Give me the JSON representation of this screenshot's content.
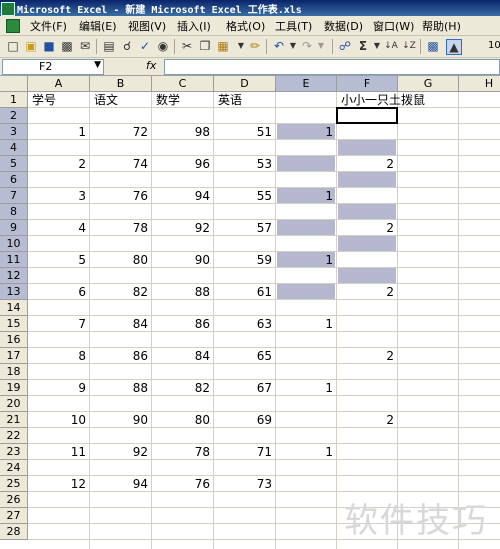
{
  "window": {
    "title": "Microsoft Excel - 新建 Microsoft Excel 工作表.xls"
  },
  "menu": [
    "文件(F)",
    "编辑(E)",
    "视图(V)",
    "插入(I)",
    "格式(O)",
    "工具(T)",
    "数据(D)",
    "窗口(W)",
    "帮助(H)"
  ],
  "toolbar": {
    "icons": [
      "new-icon",
      "open-icon",
      "save-icon",
      "permission-icon",
      "email-icon",
      "print-icon",
      "print-preview-icon",
      "spelling-icon",
      "research-icon",
      "cut-icon",
      "copy-icon",
      "paste-icon",
      "format-painter-icon",
      "undo-icon",
      "redo-icon",
      "hyperlink-icon",
      "autosum-icon",
      "sort-ascending-icon",
      "sort-descending-icon",
      "chart-wizard-icon",
      "drawing-icon"
    ],
    "zoom": "10"
  },
  "formula_bar": {
    "name_box": "F2",
    "fx": "fx",
    "content": ""
  },
  "columns": [
    "A",
    "B",
    "C",
    "D",
    "E",
    "F",
    "G",
    "H"
  ],
  "rows": [
    "1",
    "2",
    "3",
    "4",
    "5",
    "6",
    "7",
    "8",
    "9",
    "10",
    "11",
    "12",
    "13",
    "14",
    "15",
    "16",
    "17",
    "18",
    "19",
    "20",
    "21",
    "22",
    "23",
    "24",
    "25",
    "26",
    "27",
    "28"
  ],
  "headers": {
    "A1": "学号",
    "B1": "语文",
    "C1": "数学",
    "D1": "英语",
    "F1": "小小一只土拨鼠"
  },
  "data_rows": [
    {
      "row": 3,
      "A": "1",
      "B": "72",
      "C": "98",
      "D": "51",
      "E": "1",
      "F": ""
    },
    {
      "row": 5,
      "A": "2",
      "B": "74",
      "C": "96",
      "D": "53",
      "E": "",
      "F": "2"
    },
    {
      "row": 7,
      "A": "3",
      "B": "76",
      "C": "94",
      "D": "55",
      "E": "1",
      "F": ""
    },
    {
      "row": 9,
      "A": "4",
      "B": "78",
      "C": "92",
      "D": "57",
      "E": "",
      "F": "2"
    },
    {
      "row": 11,
      "A": "5",
      "B": "80",
      "C": "90",
      "D": "59",
      "E": "1",
      "F": ""
    },
    {
      "row": 13,
      "A": "6",
      "B": "82",
      "C": "88",
      "D": "61",
      "E": "",
      "F": "2"
    },
    {
      "row": 15,
      "A": "7",
      "B": "84",
      "C": "86",
      "D": "63",
      "E": "1",
      "F": ""
    },
    {
      "row": 17,
      "A": "8",
      "B": "86",
      "C": "84",
      "D": "65",
      "E": "",
      "F": "2"
    },
    {
      "row": 19,
      "A": "9",
      "B": "88",
      "C": "82",
      "D": "67",
      "E": "1",
      "F": ""
    },
    {
      "row": 21,
      "A": "10",
      "B": "90",
      "C": "80",
      "D": "69",
      "E": "",
      "F": "2"
    },
    {
      "row": 23,
      "A": "11",
      "B": "92",
      "C": "78",
      "D": "71",
      "E": "1",
      "F": ""
    },
    {
      "row": 25,
      "A": "12",
      "B": "94",
      "C": "76",
      "D": "73",
      "E": "",
      "F": ""
    }
  ],
  "highlight": {
    "color": "#b5b7cf",
    "E_rows": [
      3,
      5,
      7,
      9,
      11,
      13
    ],
    "F_rows": [
      4,
      6,
      8,
      10,
      12
    ]
  },
  "selection": {
    "active_cell": "F2",
    "selected_columns": [
      "E",
      "F"
    ],
    "selected_rows": [
      "2",
      "3",
      "4",
      "5",
      "6",
      "7",
      "8",
      "9",
      "10",
      "11",
      "12",
      "13"
    ]
  },
  "watermark": "软件技巧"
}
